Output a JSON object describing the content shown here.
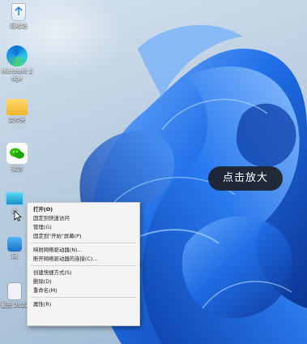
{
  "desktop": {
    "icons": [
      {
        "name": "recycle-bin",
        "label": "回收站"
      },
      {
        "name": "edge",
        "label": "Microsoft Edge"
      },
      {
        "name": "folder",
        "label": "文件夹"
      },
      {
        "name": "wechat",
        "label": "微信"
      },
      {
        "name": "monitor",
        "label": "此"
      },
      {
        "name": "network",
        "label": "网"
      },
      {
        "name": "file",
        "label": "截图 2022"
      }
    ]
  },
  "overlay": {
    "zoom_hint": "点击放大"
  },
  "context_menu": {
    "items": [
      {
        "label": "打开(O)",
        "bold": true
      },
      {
        "label": "固定到快速访问"
      },
      {
        "label": "管理(G)"
      },
      {
        "label": "固定到\"开始\"屏幕(P)"
      },
      {
        "separator": true
      },
      {
        "label": "映射网络驱动器(N)..."
      },
      {
        "label": "断开网络驱动器的连接(C)..."
      },
      {
        "separator": true
      },
      {
        "label": "创建快捷方式(S)"
      },
      {
        "label": "删除(D)"
      },
      {
        "label": "重命名(M)"
      },
      {
        "separator": true
      },
      {
        "label": "属性(R)"
      }
    ]
  },
  "colors": {
    "bloom_dark": "#0b3fa8",
    "bloom_mid": "#1f6ee8",
    "bloom_light": "#6fb0ff",
    "menu_bg": "#f4f4f4",
    "pill_bg": "#1c1e24"
  }
}
